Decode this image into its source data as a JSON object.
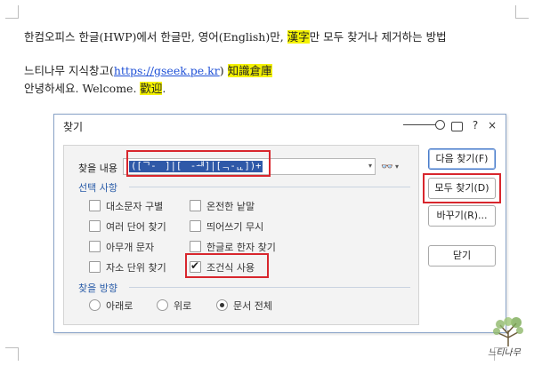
{
  "document": {
    "line1_prefix": "한컴오피스 한글(HWP)에서 한글만, 영어(English)만, ",
    "line1_highlight": "漢字",
    "line1_suffix": "만 모두 찾거나 제거하는 방법",
    "line2_prefix": "느티나무 지식창고(",
    "line2_link": "https://gseek.pe.kr",
    "line2_close": ")",
    "line2_highlight": "知識倉庫",
    "line3_prefix": "안녕하세요. Welcome. ",
    "line3_highlight": "歡迎",
    "line3_suffix": ".",
    "highlight_color": "#f4f200"
  },
  "dialog": {
    "title": "찾기",
    "help_glyph": "?",
    "close_glyph": "×",
    "find_label": "찾을 내용",
    "find_value": "([ᄀ-ᅟ]|[ᅠ-ᆧ]|[ᆨ-ᇿ])+",
    "binoculars_glyph": "👓",
    "dropdown_arrow": "▾",
    "options_section": "선택 사항",
    "options": [
      {
        "label": "대소문자 구별",
        "checked": false
      },
      {
        "label": "온전한 낱말",
        "checked": false
      },
      {
        "label": "여러 단어 찾기",
        "checked": false
      },
      {
        "label": "띄어쓰기 무시",
        "checked": false
      },
      {
        "label": "아무개 문자",
        "checked": false
      },
      {
        "label": "한글로 한자 찾기",
        "checked": false
      },
      {
        "label": "자소 단위 찾기",
        "checked": false
      },
      {
        "label": "조건식 사용",
        "checked": true
      }
    ],
    "direction_section": "찾을 방향",
    "directions": [
      {
        "label": "아래로",
        "selected": false
      },
      {
        "label": "위로",
        "selected": false
      },
      {
        "label": "문서 전체",
        "selected": true
      }
    ],
    "buttons": {
      "find_next": "다음 찾기(F)",
      "find_all": "모두 찾기(D)",
      "replace": "바꾸기(R)...",
      "close": "닫기"
    }
  },
  "watermark": {
    "text": "느티나무"
  },
  "colors": {
    "annotation_red": "#d8262d",
    "section_blue": "#2a5ca8",
    "selection_blue": "#2f59a8"
  }
}
